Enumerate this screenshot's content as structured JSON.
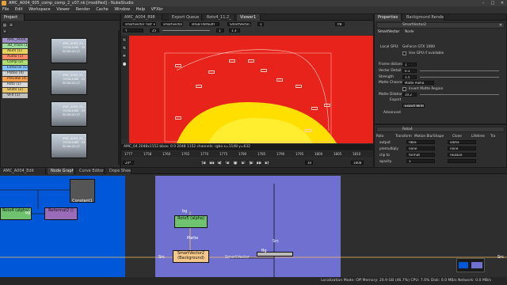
{
  "window": {
    "title": "AMC_A004_005_comp_comp_2_v07.nk [modified] - NukeStudio",
    "controls": [
      "–",
      "□",
      "✕"
    ]
  },
  "menu": [
    "File",
    "Edit",
    "Workspace",
    "Viewer",
    "Render",
    "Cache",
    "Window",
    "Help",
    "VFXbr"
  ],
  "project": {
    "tab": "Project",
    "tree": [
      "AMC_A004_53_Ch...",
      "3D_Track (1)",
      "Alum (1)",
      "Audio (1)",
      "Comp (2)",
      "Editorial (1)",
      "Plates (4)",
      "Preview (4)",
      "Roto (1)",
      "Shots (2)",
      "VFX (1)"
    ],
    "tree_colors": [
      "#9c8fc7",
      "#9ddc9e",
      "#e8d45a",
      "#ff8a65",
      "#b0e070",
      "#80c0ff",
      "#d0d0d0",
      "#ff9f4d",
      "#d9d9d9",
      "#e8c56a",
      "#bfbfbf"
    ],
    "thumbs": [
      [
        "AMC_A004_53_...",
        "1920x1080 · 24",
        "00:00:41:17"
      ],
      [
        "AMC_A004_53_...",
        "1920x1080 · 24",
        "00:00:41:17"
      ],
      [
        "AMC_A004_53_...",
        "1920x1080 · 24",
        "00:00:41:17"
      ],
      [
        "AMC_A004_53_...",
        "1920x1080 · 24",
        "00:00:41:17"
      ]
    ]
  },
  "viewer": {
    "tabs": [
      "AMC_A004_898",
      "Export Queue",
      "Roto4_11.2_",
      "Viewer1"
    ],
    "controls": [
      "smartvector_hist_v01",
      "smartvector",
      "sRGB (default)",
      "SmartVector2",
      "1",
      "Y",
      "25",
      "1",
      "1.3",
      "f/8"
    ],
    "info": "AMC_04 2048x1152  bbox: 0 0 2048 1152 channels: rgba  x=1148 y=632",
    "timeline": {
      "ticks": [
        "1777",
        "1758",
        "1760",
        "1765",
        "1770",
        "1775",
        "1780",
        "1785",
        "1790",
        "1795",
        "1800",
        "1805",
        "1810"
      ],
      "frame": "1808",
      "fps": "24*",
      "playback": [
        "|◀",
        "◀◀",
        "◀|",
        "◀",
        "■",
        "▶",
        "|▶",
        "▶▶",
        "▶|"
      ],
      "count": "10"
    }
  },
  "properties": {
    "tabs": [
      "Properties",
      "Background Renders"
    ],
    "node": "SmartVector2",
    "sub_tabs": [
      "SmartVector",
      "Node"
    ],
    "local_gpu_label": "Local GPU:",
    "local_gpu": "GeForce GTX 1080",
    "use_gpu": "Use GPU if available",
    "frame_distance_label": "Frame distance",
    "frame_distance": "1",
    "vector_detail_label": "Vector Detail",
    "vector_detail": "0.3",
    "strength_label": "Strength",
    "strength": "1.5",
    "matte_channel_label": "Matte Channel",
    "matte_channel": "Matte Alpha",
    "invert_matte": "Invert Matte Region",
    "matte_dilation_label": "Matte Dilation",
    "matte_dilation": "10.2",
    "export_label": "Export",
    "export_btn": "Export Write",
    "advanced": "Advanced"
  },
  "roto": {
    "node": "Roto4",
    "tabs": [
      "Roto",
      "Transform",
      "Motion Blur",
      "Shape",
      "Clone",
      "Lifetime",
      "Tra"
    ],
    "rows": [
      [
        "output",
        "rgba",
        "alpha"
      ],
      [
        "premultiply",
        "none",
        "none"
      ],
      [
        "clip to",
        "format",
        "replace"
      ],
      [
        "opacity",
        "1",
        ""
      ]
    ]
  },
  "nodegraph": {
    "tabs": [
      "AMC_A004_Edit",
      "Node Graph",
      "Curve Editor",
      "Dope Sheet"
    ],
    "nodes": {
      "roto4": "Roto4 (alpha)",
      "reformat2": "Reformat2 ()",
      "constant1": "Constant1",
      "roto5": "Roto5 (alpha)",
      "smartvector2": "SmartVector2 (Background)"
    },
    "labels": {
      "bg": "bg",
      "bg2": "bg",
      "matte": "Matte",
      "src": "Src",
      "src2": "Src",
      "src3": "Src",
      "smartvector": "SmartVector",
      "bg3": "Bg"
    }
  },
  "status": "Localization Mode: Off   Memory: 20.9 GB (46.7%)   CPU: 7.6%   Disk: 0.0 MB/s   Network: 0.0 MB/s"
}
